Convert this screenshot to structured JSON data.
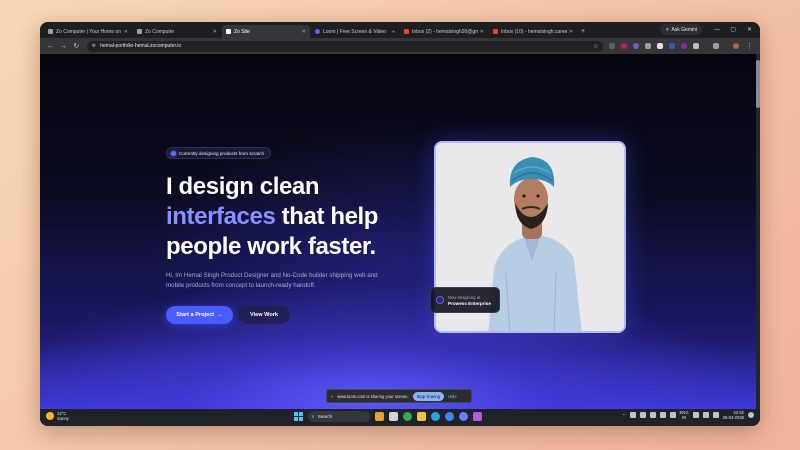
{
  "browser": {
    "tabs": [
      {
        "label": "Zo Computer | Your Home on t",
        "favicon_color": "#9aa0a6",
        "active": false
      },
      {
        "label": "Zo Computer",
        "favicon_color": "#9aa0a6",
        "active": false
      },
      {
        "label": "Zo Site",
        "favicon_color": "#ffffff",
        "active": true
      },
      {
        "label": "Loom | Free Screen & Video",
        "favicon_color": "#625df5",
        "active": false
      },
      {
        "label": "Inbox (2) - hemalsingh26@gm",
        "favicon_color": "#ea4335",
        "active": false
      },
      {
        "label": "Inbox (10) - hemalsingh.career",
        "favicon_color": "#ea4335",
        "active": false
      }
    ],
    "new_tab": "+",
    "ask_gemini": "Ask Gemini",
    "window_controls": {
      "minimize": "—",
      "maximize": "▢",
      "close": "✕"
    },
    "url": "hemal-portfolio-hemal.zocomputer.io",
    "nav": {
      "back": "←",
      "forward": "→",
      "reload": "↻"
    }
  },
  "hero": {
    "badge": "Currently designing products from scratch",
    "headline": {
      "line1": "I design clean",
      "line2_accent": "interfaces",
      "line2_rest": " that help",
      "line3": "people work faster."
    },
    "subtitle": "Hi, Im Hemal Singh Product Designer and No-Code builder shipping web and mobile products from concept to launch-ready handoff.",
    "primary_cta": "Start a Project",
    "primary_cta_arrow": "→",
    "secondary_cta": "View Work",
    "floating_card": {
      "caption": "Now designing at",
      "company": "Prowess Enterprise"
    }
  },
  "screen_share": {
    "message": "www.loom.com is sharing your screen.",
    "stop_label": "Stop sharing",
    "hide_label": "Hide"
  },
  "taskbar": {
    "weather_temp": "12°C",
    "weather_desc": "Sunny",
    "search_label": "Search",
    "lang_top": "ENG",
    "lang_bottom": "IN",
    "time": "22:52",
    "date": "26-04-2026"
  },
  "colors": {
    "accent": "#8b90ff",
    "primary_button": "#4b5cff",
    "page_bg_top": "#060610",
    "page_bg_bottom": "#3c3ad8"
  }
}
